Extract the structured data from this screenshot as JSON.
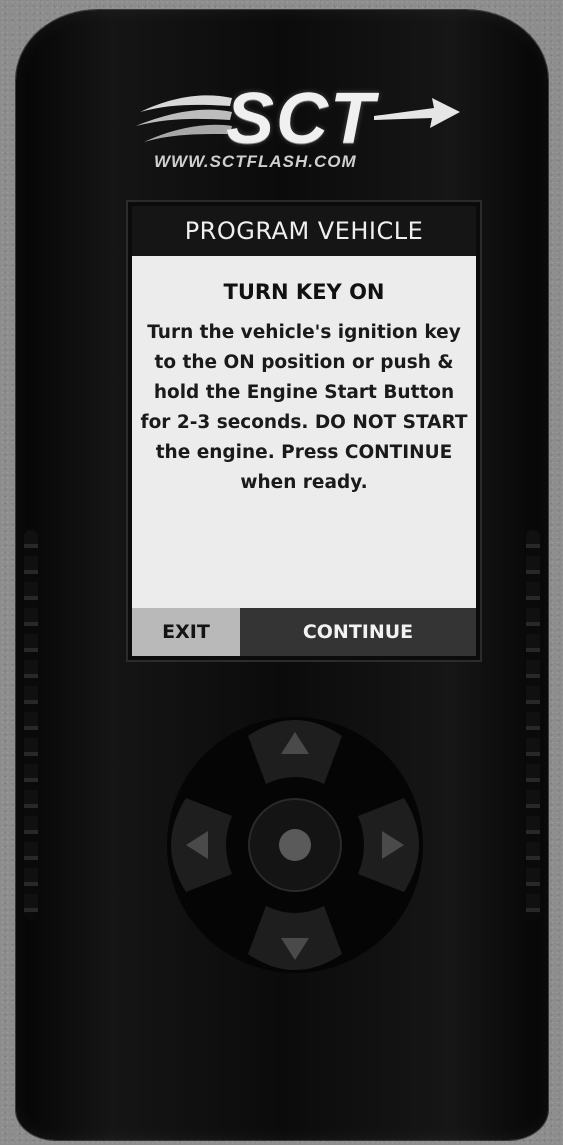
{
  "brand": {
    "logo_text": "SCT",
    "url": "WWW.SCTFLASH.COM"
  },
  "screen": {
    "title": "PROGRAM VEHICLE",
    "heading": "TURN KEY ON",
    "message_lines": [
      "Turn the vehicle's ignition key",
      "to the ON position or push &",
      "hold the Engine Start Button",
      "for 2-3 seconds. DO NOT START",
      "the engine. Press CONTINUE",
      "when ready."
    ],
    "buttons": {
      "exit": "EXIT",
      "continue": "CONTINUE"
    }
  },
  "colors": {
    "device_body": "#0f0f0f",
    "screen_bg": "#ececec",
    "title_bar": "#151515",
    "exit_button": "#b9b9b9",
    "continue_button": "#343434"
  },
  "dpad_icons": [
    "arrow-up-icon",
    "arrow-down-icon",
    "arrow-left-icon",
    "arrow-right-icon",
    "select-dot-icon"
  ]
}
